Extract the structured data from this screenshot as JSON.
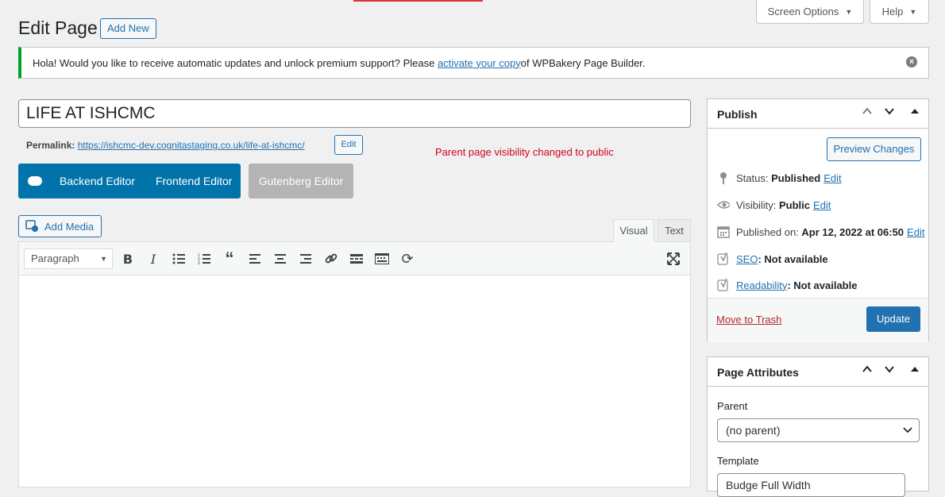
{
  "header": {
    "title": "Edit Page",
    "add_new": "Add New",
    "screen_options": "Screen Options",
    "help": "Help"
  },
  "notice": {
    "text_before": "Hola! Would you like to receive automatic updates and unlock premium support? Please ",
    "link": "activate your copy",
    "text_after": " of WPBakery Page Builder.",
    "close_icon": "close-circle-icon"
  },
  "post": {
    "title": "LIFE AT ISHCMC",
    "permalink_label": "Permalink:",
    "permalink_url": "https://ishcmc-dev.cognitastaging.co.uk/life-at-ishcmc/",
    "permalink_edit": "Edit"
  },
  "annotation": "Parent page visibility changed to public",
  "wpbakery": {
    "backend": "Backend Editor",
    "frontend": "Frontend Editor",
    "gutenberg": "Gutenberg Editor"
  },
  "editor": {
    "add_media": "Add Media",
    "tab_visual": "Visual",
    "tab_text": "Text",
    "format": "Paragraph",
    "toolbar_icons": [
      "bold-icon",
      "italic-icon",
      "bullet-list-icon",
      "numbered-list-icon",
      "blockquote-icon",
      "align-left-icon",
      "align-center-icon",
      "align-right-icon",
      "link-icon",
      "read-more-icon",
      "toolbar-toggle-icon",
      "wpbakery-refresh-icon",
      "fullscreen-icon"
    ]
  },
  "publish": {
    "title": "Publish",
    "preview": "Preview Changes",
    "status_label": "Status:",
    "status_value": "Published",
    "visibility_label": "Visibility:",
    "visibility_value": "Public",
    "published_label": "Published on:",
    "published_value": "Apr 12, 2022 at 06:50",
    "edit": "Edit",
    "seo_link": "SEO",
    "seo_value": ": Not available",
    "readability_link": "Readability",
    "readability_value": ": Not available",
    "trash": "Move to Trash",
    "update": "Update"
  },
  "attributes": {
    "title": "Page Attributes",
    "parent_label": "Parent",
    "parent_value": "(no parent)",
    "template_label": "Template",
    "template_value": "Budge Full Width"
  },
  "colors": {
    "accent": "#2271b1",
    "wpbakery": "#0073aa",
    "notice_border": "#00a32a",
    "annotation": "#d0021b",
    "trash": "#b32d2e"
  }
}
